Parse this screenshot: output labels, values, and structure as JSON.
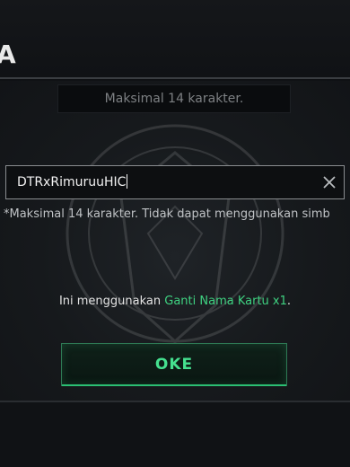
{
  "header": {
    "title_fragment": "A"
  },
  "dialog": {
    "hint_text": "Maksimal 14 karakter.",
    "input": {
      "value": "DTRxRimuruuHIC"
    },
    "note": "*Maksimal 14 karakter. Tidak dapat menggunakan simb",
    "usage": {
      "prefix": "Ini menggunakan ",
      "item": "Ganti Nama Kartu x1",
      "suffix": "."
    },
    "ok_label": "OKE"
  },
  "icons": {
    "clear": "close-icon",
    "background_emblem": "emblem-icon"
  },
  "colors": {
    "accent_green": "#3fd281",
    "button_border": "#2e7a55",
    "text_primary": "#f2f2f2",
    "text_muted": "#7d8083",
    "background": "#0f1114"
  }
}
